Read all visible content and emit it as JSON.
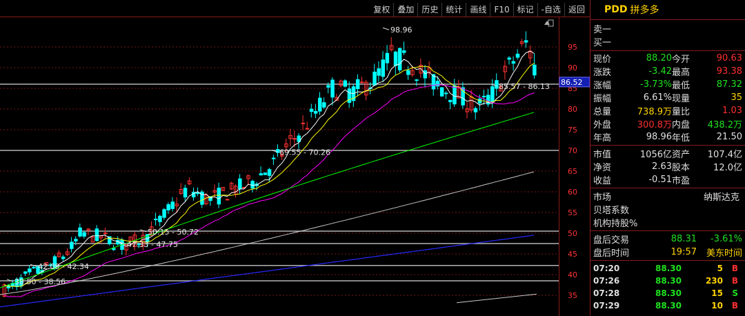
{
  "toolbar": [
    "复权",
    "叠加",
    "历史",
    "统计",
    "画线",
    "F10",
    "标记",
    "-自选",
    "返回"
  ],
  "stock": {
    "symbol": "PDD",
    "name": "拼多多"
  },
  "orderbook": {
    "sell1": "卖一",
    "buy1": "买一"
  },
  "quote": [
    {
      "l1": "现价",
      "v1": "88.20",
      "c1": "green",
      "l2": "今开",
      "v2": "90.63",
      "c2": "red"
    },
    {
      "l1": "涨跌",
      "v1": "-3.42",
      "c1": "green",
      "l2": "最高",
      "v2": "93.38",
      "c2": "red"
    },
    {
      "l1": "涨幅",
      "v1": "-3.73%",
      "c1": "green",
      "l2": "最低",
      "v2": "87.32",
      "c2": "green"
    },
    {
      "l1": "振幅",
      "v1": "6.61%",
      "c1": "white",
      "l2": "现量",
      "v2": "35",
      "c2": "yellow"
    },
    {
      "l1": "总量",
      "v1": "738.9万",
      "c1": "yellow",
      "l2": "量比",
      "v2": "1.03",
      "c2": "red"
    },
    {
      "l1": "外盘",
      "v1": "300.8万",
      "c1": "red",
      "l2": "内盘",
      "v2": "438.2万",
      "c2": "green"
    },
    {
      "l1": "年高",
      "v1": "98.96",
      "c1": "white",
      "l2": "年低",
      "v2": "21.50",
      "c2": "white"
    }
  ],
  "fundamentals": [
    {
      "l1": "市值",
      "v1": "1056亿",
      "l2": "资产",
      "v2": "107.4亿"
    },
    {
      "l1": "净资",
      "v1": "2.63",
      "l2": "股本",
      "v2": "12.0亿"
    },
    {
      "l1": "收益",
      "v1": "-0.51",
      "l2": "市盈",
      "v2": ""
    }
  ],
  "market": {
    "label": "市场",
    "value": "纳斯达克",
    "beta_label": "贝塔系数",
    "inst_label": "机构持股%"
  },
  "afterhours": {
    "trade_label": "盘后交易",
    "price": "88.31",
    "pct": "-3.61%",
    "time_label": "盘后时间",
    "time": "19:57",
    "tz": "美东时间"
  },
  "trades": [
    {
      "time": "07:20",
      "price": "88.30",
      "vol": "5",
      "side": "B"
    },
    {
      "time": "07:26",
      "price": "88.30",
      "vol": "230",
      "side": "B"
    },
    {
      "time": "07:28",
      "price": "88.30",
      "vol": "15",
      "side": "S"
    },
    {
      "time": "07:29",
      "price": "88.30",
      "vol": "10",
      "side": "B"
    }
  ],
  "colors": {
    "up": "#ff3232",
    "down": "#00ffff",
    "ma5": "#ffffff",
    "ma10": "#ffff00",
    "ma20": "#ff00ff",
    "ma60": "#00ff00",
    "ma120": "#c8c8c8",
    "ma250": "#2828ff",
    "divider": "#8a1c1c"
  },
  "chart_data": {
    "type": "candlestick",
    "ylim": [
      30,
      100
    ],
    "y_ticks": [
      35,
      40,
      45,
      50,
      55,
      60,
      65,
      70,
      75,
      80,
      85,
      90,
      95
    ],
    "current_price_label": "86.52",
    "annotations": [
      {
        "text": "98.96",
        "x": 565,
        "y": 98.96
      },
      {
        "text": "85.57 - 86.13",
        "x": 722,
        "y": 85.3
      },
      {
        "text": "69.55 - 70.26",
        "x": 404,
        "y": 69.4
      },
      {
        "text": "50.15 - 50.72",
        "x": 213,
        "y": 50.2
      },
      {
        "text": "47.33 - 47.75",
        "x": 183,
        "y": 47.2
      },
      {
        "text": "42.09 - 42.34",
        "x": 54,
        "y": 41.8
      },
      {
        "text": "38.50 - 38.56",
        "x": 20,
        "y": 38.2
      }
    ],
    "hlines": [
      86.0,
      70.0,
      50.5,
      47.5,
      42.2,
      38.5
    ]
  }
}
